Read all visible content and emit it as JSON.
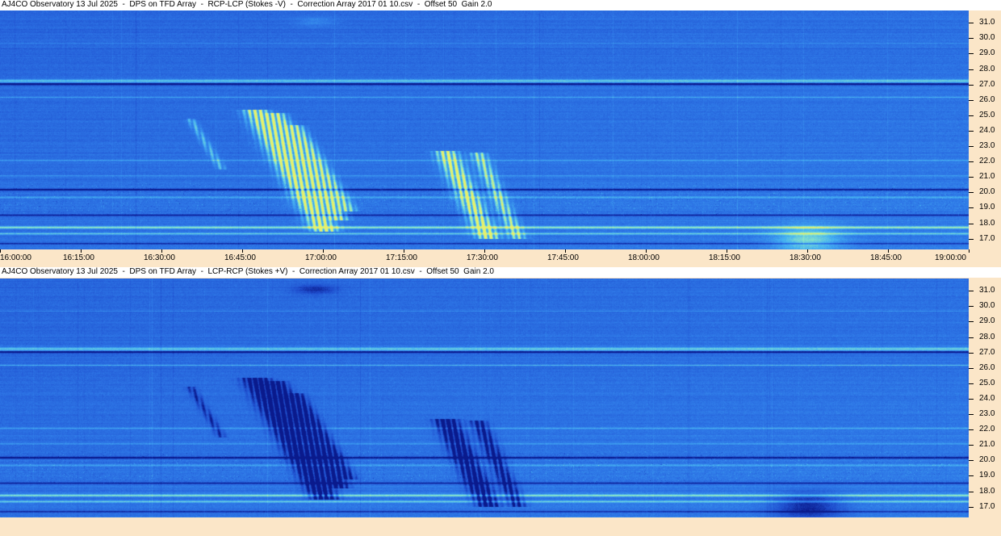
{
  "chart_data": [
    {
      "type": "heatmap",
      "title": "AJ4CO Observatory 13 Jul 2025  -  DPS on TFD Array  -  RCP-LCP (Stokes -V)  -  Correction Array 2017 01 10.csv  -  Offset 50  Gain 2.0",
      "polarity": "emission-bright",
      "x_ticks": [
        "16:00:00",
        "16:15:00",
        "16:30:00",
        "16:45:00",
        "17:00:00",
        "17:15:00",
        "17:30:00",
        "17:45:00",
        "18:00:00",
        "18:15:00",
        "18:30:00",
        "18:45:00",
        "19:00:00"
      ],
      "y_ticks": [
        "31.0",
        "30.0",
        "29.0",
        "28.0",
        "27.0",
        "26.0",
        "25.0",
        "24.0",
        "23.0",
        "22.0",
        "21.0",
        "20.0",
        "19.0",
        "18.0",
        "17.0"
      ],
      "xlim": [
        "16:00:00",
        "19:00:00"
      ],
      "ylim_mhz": [
        16.3,
        31.8
      ],
      "colormap": [
        "#0a1a8c",
        "#1f4fcf",
        "#2f7ae8",
        "#46b2f2",
        "#8fe8c8",
        "#e8f06a"
      ]
    },
    {
      "type": "heatmap",
      "title": "AJ4CO Observatory 13 Jul 2025  -  DPS on TFD Array  -  LCP-RCP (Stokes +V)  -  Correction Array 2017 01 10.csv  -  Offset 50  Gain 2.0",
      "polarity": "emission-dark",
      "x_ticks": [],
      "y_ticks": [
        "31.0",
        "30.0",
        "29.0",
        "28.0",
        "27.0",
        "26.0",
        "25.0",
        "24.0",
        "23.0",
        "22.0",
        "21.0",
        "20.0",
        "19.0",
        "18.0",
        "17.0"
      ],
      "xlim": [
        "16:00:00",
        "19:00:00"
      ],
      "ylim_mhz": [
        16.3,
        31.8
      ],
      "colormap": [
        "#0a1a8c",
        "#1f4fcf",
        "#2f7ae8",
        "#46b2f2",
        "#8fe8c8",
        "#e8f06a"
      ]
    }
  ]
}
